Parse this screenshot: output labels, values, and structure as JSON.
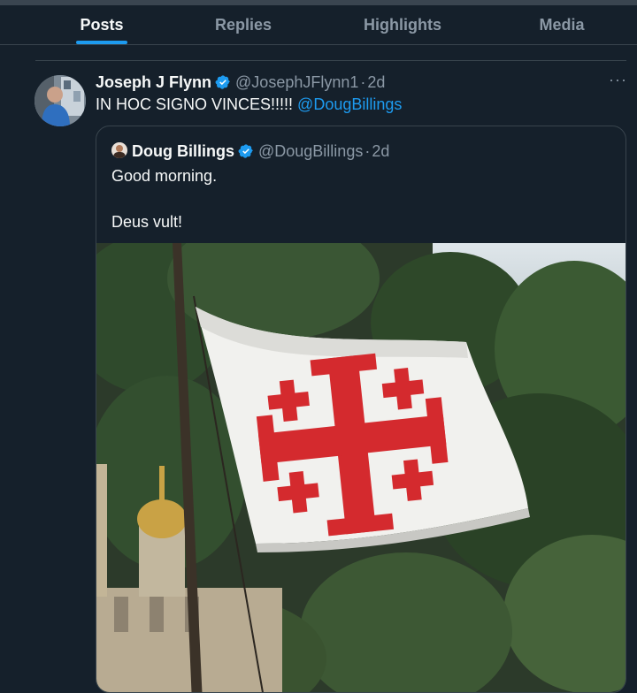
{
  "tabs": [
    {
      "label": "Posts",
      "active": true
    },
    {
      "label": "Replies",
      "active": false
    },
    {
      "label": "Highlights",
      "active": false
    },
    {
      "label": "Media",
      "active": false
    }
  ],
  "tweet": {
    "author_name": "Joseph J Flynn",
    "handle": "@JosephJFlynn1",
    "separator": "·",
    "time": "2d",
    "text": "IN HOC SIGNO VINCES!!!!! ",
    "mention": "@DougBillings",
    "more_label": "···",
    "verified_icon": "verified-badge-icon"
  },
  "quoted_tweet": {
    "author_name": "Doug Billings",
    "handle": "@DougBillings",
    "separator": "·",
    "time": "2d",
    "line1": "Good morning.",
    "line2": "Deus vult!",
    "image_subject": "jerusalem-cross-flag"
  },
  "colors": {
    "background": "#15202b",
    "accent": "#1d9bf0",
    "text_primary": "#f7f9f9",
    "text_secondary": "#8b98a5",
    "border": "#38444d",
    "flag_cross": "#d42a2e"
  }
}
